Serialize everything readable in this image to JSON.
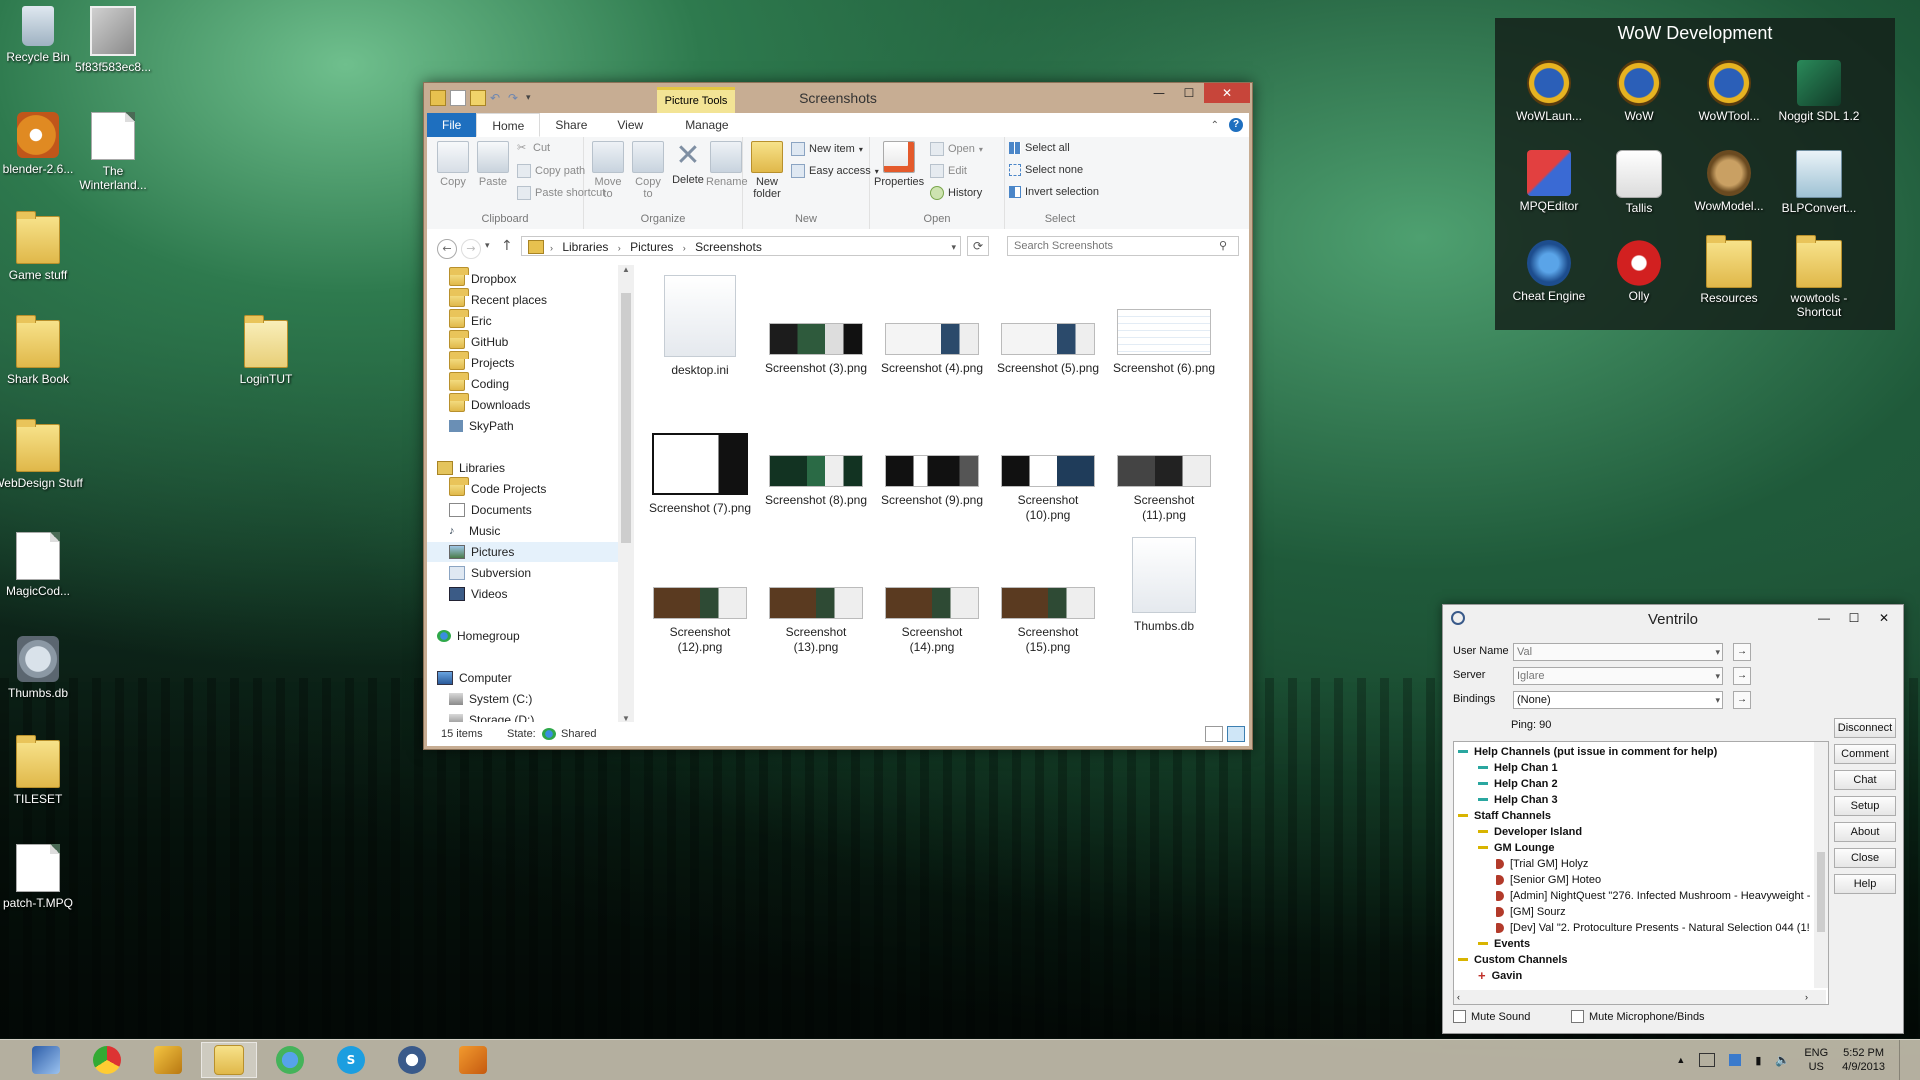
{
  "desktop": {
    "icons": [
      {
        "label": "Recycle Bin"
      },
      {
        "label": "5f83f583ec8..."
      },
      {
        "label": "blender-2.6..."
      },
      {
        "label": "The Winterland..."
      },
      {
        "label": "Game stuff"
      },
      {
        "label": "Shark Book"
      },
      {
        "label": "LoginTUT"
      },
      {
        "label": "WebDesign Stuff"
      },
      {
        "label": "MagicCod..."
      },
      {
        "label": "Thumbs.db"
      },
      {
        "label": "TILESET"
      },
      {
        "label": "patch-T.MPQ"
      }
    ]
  },
  "dev_panel": {
    "title": "WoW Development",
    "icons": [
      {
        "label": "WoWLaun..."
      },
      {
        "label": "WoW"
      },
      {
        "label": "WoWTool..."
      },
      {
        "label": "Noggit SDL 1.2"
      },
      {
        "label": "MPQEditor"
      },
      {
        "label": "Tallis"
      },
      {
        "label": "WowModel..."
      },
      {
        "label": "BLPConvert..."
      },
      {
        "label": "Cheat Engine"
      },
      {
        "label": "Olly"
      },
      {
        "label": "Resources"
      },
      {
        "label": "wowtools - Shortcut"
      }
    ]
  },
  "explorer": {
    "title": "Screenshots",
    "picture_tools": "Picture Tools",
    "tabs": [
      {
        "label": "File"
      },
      {
        "label": "Home"
      },
      {
        "label": "Share"
      },
      {
        "label": "View"
      },
      {
        "label": "Manage"
      }
    ],
    "ribbon": {
      "clipboard": {
        "name": "Clipboard",
        "copy": "Copy",
        "paste": "Paste",
        "cut": "Cut",
        "copy_path": "Copy path",
        "paste_shortcut": "Paste shortcut"
      },
      "organize": {
        "name": "Organize",
        "move_to": "Move to",
        "copy_to": "Copy to",
        "delete": "Delete",
        "rename": "Rename"
      },
      "new": {
        "name": "New",
        "new_folder": "New folder",
        "new_item": "New item",
        "easy_access": "Easy access"
      },
      "open": {
        "name": "Open",
        "properties": "Properties",
        "open": "Open",
        "edit": "Edit",
        "history": "History"
      },
      "select": {
        "name": "Select",
        "select_all": "Select all",
        "select_none": "Select none",
        "invert_selection": "Invert selection"
      }
    },
    "breadcrumb": [
      "Libraries",
      "Pictures",
      "Screenshots"
    ],
    "search_placeholder": "Search Screenshots",
    "nav": [
      {
        "label": "Dropbox"
      },
      {
        "label": "Recent places"
      },
      {
        "label": "Eric"
      },
      {
        "label": "GitHub"
      },
      {
        "label": "Projects"
      },
      {
        "label": "Coding"
      },
      {
        "label": "Downloads"
      },
      {
        "label": "SkyPath"
      },
      {
        "label": "Libraries"
      },
      {
        "label": "Code Projects"
      },
      {
        "label": "Documents"
      },
      {
        "label": "Music"
      },
      {
        "label": "Pictures"
      },
      {
        "label": "Subversion"
      },
      {
        "label": "Videos"
      },
      {
        "label": "Homegroup"
      },
      {
        "label": "Computer"
      },
      {
        "label": "System (C:)"
      },
      {
        "label": "Storage (D:)"
      }
    ],
    "files": [
      {
        "name": "desktop.ini"
      },
      {
        "name": "Screenshot (3).png"
      },
      {
        "name": "Screenshot (4).png"
      },
      {
        "name": "Screenshot (5).png"
      },
      {
        "name": "Screenshot (6).png"
      },
      {
        "name": "Screenshot (7).png"
      },
      {
        "name": "Screenshot (8).png"
      },
      {
        "name": "Screenshot (9).png"
      },
      {
        "name": "Screenshot (10).png"
      },
      {
        "name": "Screenshot (11).png"
      },
      {
        "name": "Screenshot (12).png"
      },
      {
        "name": "Screenshot (13).png"
      },
      {
        "name": "Screenshot (14).png"
      },
      {
        "name": "Screenshot (15).png"
      },
      {
        "name": "Thumbs.db"
      }
    ],
    "status": {
      "count": "15 items",
      "state_label": "State:",
      "state_value": "Shared"
    }
  },
  "ventrilo": {
    "title": "Ventrilo",
    "user_name_label": "User Name",
    "user_name_value": "Val",
    "server_label": "Server",
    "server_value": "Iglare",
    "bindings_label": "Bindings",
    "bindings_value": "(None)",
    "ping": "Ping: 90",
    "buttons": [
      "Disconnect",
      "Comment",
      "Chat",
      "Setup",
      "About",
      "Close",
      "Help"
    ],
    "tree": [
      {
        "label": "Help Channels (put issue in comment for help)",
        "level": 0,
        "kind": "chan-cyan"
      },
      {
        "label": "Help Chan 1",
        "level": 1,
        "kind": "chan-cyan"
      },
      {
        "label": "Help Chan 2",
        "level": 1,
        "kind": "chan-cyan"
      },
      {
        "label": "Help Chan 3",
        "level": 1,
        "kind": "chan-cyan"
      },
      {
        "label": "Staff Channels",
        "level": 0,
        "kind": "chan-yellow"
      },
      {
        "label": "Developer Island",
        "level": 1,
        "kind": "chan-yellow"
      },
      {
        "label": "GM Lounge",
        "level": 1,
        "kind": "chan-yellow"
      },
      {
        "label": "[Trial GM] Holyz",
        "level": 2,
        "kind": "user"
      },
      {
        "label": "[Senior GM] Hoteo",
        "level": 2,
        "kind": "user"
      },
      {
        "label": "[Admin] NightQuest \"276. Infected Mushroom - Heavyweight -",
        "level": 2,
        "kind": "user"
      },
      {
        "label": "[GM] Sourz",
        "level": 2,
        "kind": "user"
      },
      {
        "label": "[Dev] Val \"2. Protoculture Presents - Natural Selection 044 (1!",
        "level": 2,
        "kind": "user"
      },
      {
        "label": "Events",
        "level": 1,
        "kind": "chan-yellow"
      },
      {
        "label": "Custom Channels",
        "level": 0,
        "kind": "chan-yellow"
      },
      {
        "label": "Gavin",
        "level": 1,
        "kind": "plus"
      }
    ],
    "mute_sound": "Mute Sound",
    "mute_mic": "Mute Microphone/Binds"
  },
  "taskbar": {
    "lang": "ENG",
    "region": "US",
    "time": "5:52 PM",
    "date": "4/9/2013"
  },
  "colors": {
    "accent": "#1e6fbf",
    "close": "#c7453a",
    "channel_cyan": "#2aa7a0",
    "channel_yellow": "#d8b400"
  }
}
